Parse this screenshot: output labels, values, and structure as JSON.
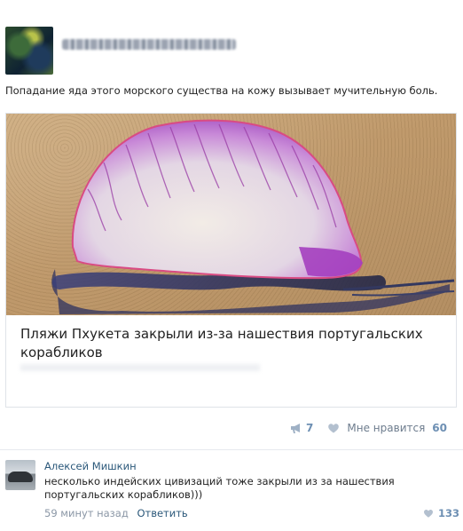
{
  "post": {
    "text": "Попадание яда этого морского существа на кожу вызывает мучительную боль."
  },
  "link": {
    "title": "Пляжи Пхукета закрыли из-за нашествия португальских корабликов"
  },
  "actions": {
    "share_count": "7",
    "like_label": "Мне нравится",
    "like_count": "60",
    "icons": [
      "megaphone-icon",
      "heart-icon"
    ]
  },
  "comment": {
    "author": "Алексей Мишкин",
    "text": "несколько индейских цивизаций тоже закрыли из за нашествия португальских корабликов)))",
    "time": "59 минут назад",
    "reply_label": "Ответить",
    "likes": "133"
  },
  "colors": {
    "link": "#2b587a",
    "accent_count": "#6d8fb3",
    "muted": "#8b97a6",
    "divider": "#e6e9ee"
  }
}
